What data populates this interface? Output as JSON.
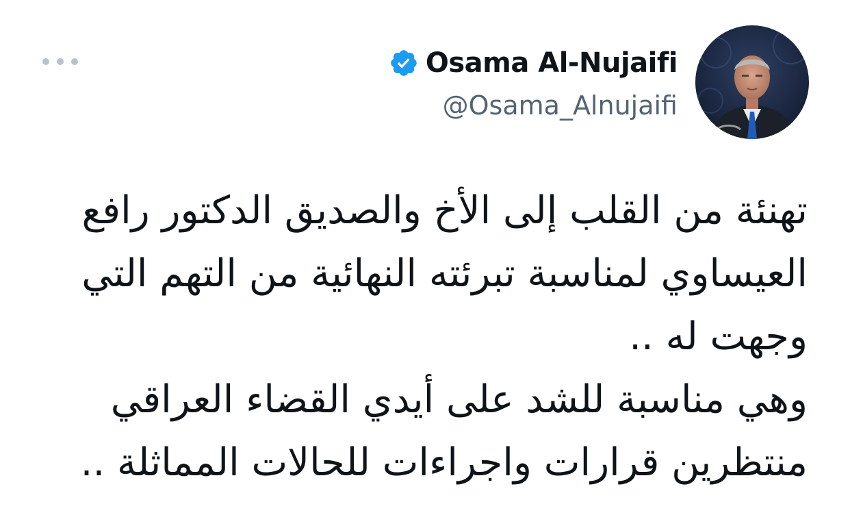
{
  "author": {
    "display_name": "Osama Al-Nujaifi",
    "handle": "@Osama_Alnujaifi",
    "verified": true,
    "avatar_icon": "profile-photo",
    "verified_icon": "verified-badge-icon"
  },
  "menu": {
    "more_icon": "more-options-icon"
  },
  "tweet": {
    "lines": [
      "تهنئة من القلب إلى الأخ والصديق الدكتور رافع",
      "العيساوي لمناسبة تبرئته النهائية من التهم التي",
      "وجهت له ..",
      "وهي مناسبة للشد على أيدي القضاء العراقي",
      "منتظرين قرارات واجراءات للحالات المماثلة .."
    ]
  },
  "colors": {
    "text": "#0f1419",
    "secondary_text": "#536471",
    "verified_blue": "#1d9bf0",
    "more_dots": "#b9c2ca"
  }
}
